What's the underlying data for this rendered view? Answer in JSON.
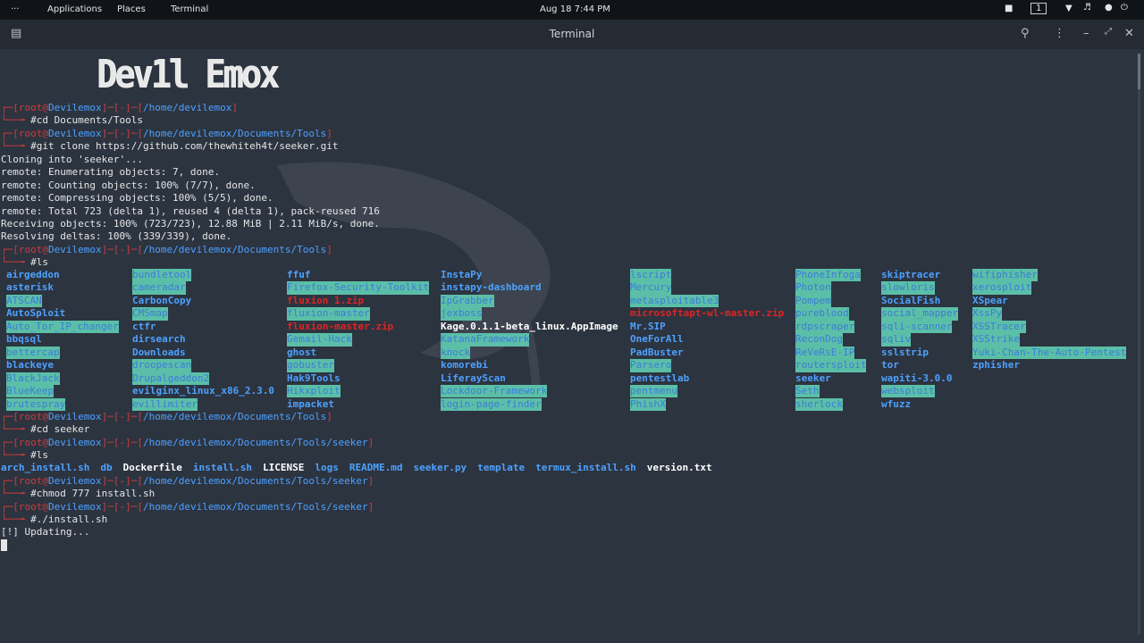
{
  "topbar": {
    "applications": "Applications",
    "places": "Places",
    "terminal": "Terminal",
    "datetime": "Aug 18  7:44 PM",
    "workspace": "1"
  },
  "window": {
    "title": "Terminal"
  },
  "banner": "Dev1l Emox",
  "prompt": {
    "user": "root",
    "at": "@",
    "host": "Devilemox",
    "dash": "[-]",
    "symbol": "#"
  },
  "lines": {
    "p1_path": "/home/devilemox",
    "c1": "cd Documents/Tools",
    "p2_path": "/home/devilemox/Documents/Tools",
    "c2": "git clone https://github.com/thewhiteh4t/seeker.git",
    "o1": "Cloning into 'seeker'...",
    "o2": "remote: Enumerating objects: 7, done.",
    "o3": "remote: Counting objects: 100% (7/7), done.",
    "o4": "remote: Compressing objects: 100% (5/5), done.",
    "o5": "remote: Total 723 (delta 1), reused 4 (delta 1), pack-reused 716",
    "o6": "Receiving objects: 100% (723/723), 12.88 MiB | 2.11 MiB/s, done.",
    "o7": "Resolving deltas: 100% (339/339), done.",
    "p3_path": "/home/devilemox/Documents/Tools",
    "c3": "ls",
    "p4_path": "/home/devilemox/Documents/Tools",
    "c4": "cd seeker",
    "p5_path": "/home/devilemox/Documents/Tools/seeker",
    "c5": "ls",
    "p6_path": "/home/devilemox/Documents/Tools/seeker",
    "c6": "chmod 777 install.sh",
    "p7_path": "/home/devilemox/Documents/Tools/seeker",
    "c7": "./install.sh",
    "o8": "[!] Updating..."
  },
  "ls_columns": [
    [
      [
        "airgeddon",
        "b"
      ],
      [
        "asterisk",
        "b"
      ],
      [
        "ATSCAN",
        "hl"
      ],
      [
        "AutoSploit",
        "b"
      ],
      [
        "Auto_Tor_IP_changer",
        "hl"
      ],
      [
        "bbqsql",
        "b"
      ],
      [
        "bettercap",
        "hl"
      ],
      [
        "blackeye",
        "b"
      ],
      [
        "BlackJack",
        "hl"
      ],
      [
        "BlueKeep",
        "hl"
      ],
      [
        "brutespray",
        "hl"
      ]
    ],
    [
      [
        "bundletool",
        "hl"
      ],
      [
        "cameradar",
        "hl"
      ],
      [
        "CarbonCopy",
        "b"
      ],
      [
        "CMSmap",
        "hl"
      ],
      [
        "ctfr",
        "b"
      ],
      [
        "dirsearch",
        "b"
      ],
      [
        "Downloads",
        "b"
      ],
      [
        "droopescan",
        "hl"
      ],
      [
        "Drupalgeddon2",
        "hl"
      ],
      [
        "evilginx_linux_x86_2.3.0",
        "b"
      ],
      [
        "evillimiter",
        "hl"
      ]
    ],
    [
      [
        "ffuf",
        "b"
      ],
      [
        "Firefox-Security-Toolkit",
        "hl"
      ],
      [
        "fluxion 1.zip",
        "red"
      ],
      [
        "fluxion-master",
        "hl"
      ],
      [
        "fluxion-master.zip",
        "red"
      ],
      [
        "Gemail-Hack",
        "hl"
      ],
      [
        "ghost",
        "b"
      ],
      [
        "gobuster",
        "hl"
      ],
      [
        "Hak9Tools",
        "b"
      ],
      [
        "Hikxploit",
        "hl"
      ],
      [
        "impacket",
        "b"
      ]
    ],
    [
      [
        "InstaPy",
        "b"
      ],
      [
        "instapy-dashboard",
        "b"
      ],
      [
        "IpGrabber",
        "hl"
      ],
      [
        "jexboss",
        "hl"
      ],
      [
        "Kage.0.1.1-beta_linux.AppImage",
        "w"
      ],
      [
        "KatanaFramework",
        "hl"
      ],
      [
        "knock",
        "hl"
      ],
      [
        "komorebi",
        "b"
      ],
      [
        "LiferayScan",
        "b"
      ],
      [
        "Lockdoor-Framework",
        "hl"
      ],
      [
        "login-page-finder",
        "hl"
      ]
    ],
    [
      [
        "lscript",
        "hl"
      ],
      [
        "Mercury",
        "hl"
      ],
      [
        "metasploitable3",
        "hl"
      ],
      [
        "microsoftapt-wl-master.zip",
        "red"
      ],
      [
        "Mr.SIP",
        "b"
      ],
      [
        "OneForAll",
        "b"
      ],
      [
        "PadBuster",
        "b"
      ],
      [
        "Parsero",
        "hl"
      ],
      [
        "pentestlab",
        "b"
      ],
      [
        "pentmenu",
        "hl"
      ],
      [
        "PhishX",
        "hl"
      ]
    ],
    [
      [
        "PhoneInfoga",
        "hl"
      ],
      [
        "Photon",
        "hl"
      ],
      [
        "Pompem",
        "hl"
      ],
      [
        "pureblood",
        "hl"
      ],
      [
        "rdpscraper",
        "hl"
      ],
      [
        "ReconDog",
        "hl"
      ],
      [
        "ReVeRsE-IP",
        "hl"
      ],
      [
        "routersploit",
        "hl"
      ],
      [
        "seeker",
        "b"
      ],
      [
        "Seth",
        "hl"
      ],
      [
        "sherlock",
        "hl"
      ]
    ],
    [
      [
        "skiptracer",
        "b"
      ],
      [
        "slowloris",
        "hl"
      ],
      [
        "SocialFish",
        "b"
      ],
      [
        "social_mapper",
        "hl"
      ],
      [
        "sqli-scanner",
        "hl"
      ],
      [
        "sqliv",
        "hl"
      ],
      [
        "sslstrip",
        "b"
      ],
      [
        "tor",
        "b"
      ],
      [
        "wapiti-3.0.0",
        "b"
      ],
      [
        "websploit",
        "hl"
      ],
      [
        "wfuzz",
        "b"
      ]
    ],
    [
      [
        "wifiphisher",
        "hl"
      ],
      [
        "xerosploit",
        "hl"
      ],
      [
        "XSpear",
        "b"
      ],
      [
        "XssPy",
        "hl"
      ],
      [
        "XSSTracer",
        "hl"
      ],
      [
        "XSStrike",
        "hl"
      ],
      [
        "Yuki-Chan-The-Auto-Pentest",
        "hl"
      ],
      [
        "zphisher",
        "b"
      ]
    ]
  ],
  "seeker_ls": [
    [
      "arch_install.sh",
      "b"
    ],
    [
      "db",
      "b"
    ],
    [
      "Dockerfile",
      "w"
    ],
    [
      "install.sh",
      "b"
    ],
    [
      "LICENSE",
      "w"
    ],
    [
      "logs",
      "b"
    ],
    [
      "README.md",
      "b"
    ],
    [
      "seeker.py",
      "b"
    ],
    [
      "template",
      "b"
    ],
    [
      "termux_install.sh",
      "b"
    ],
    [
      "version.txt",
      "w"
    ]
  ]
}
